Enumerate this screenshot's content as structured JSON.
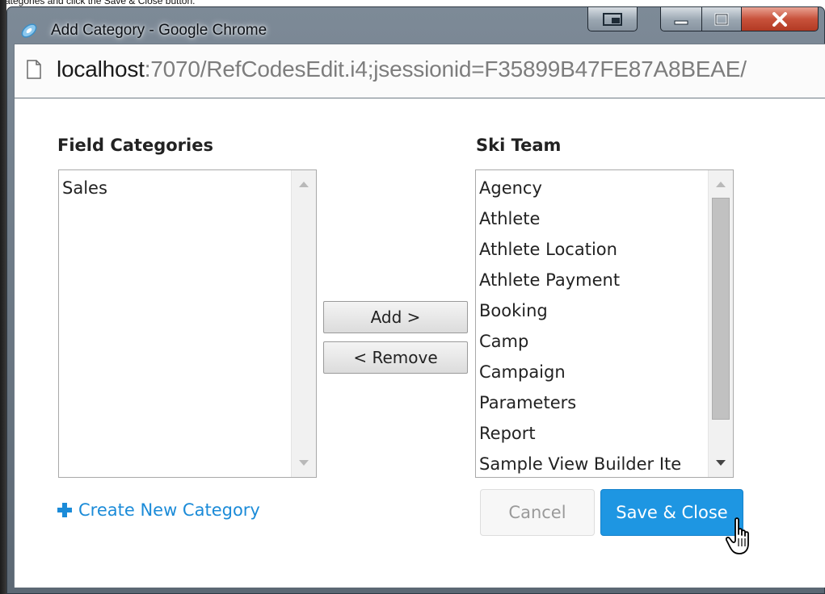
{
  "caption": "categories and click the Save & Close button.",
  "window": {
    "title": "Add Category - Google Chrome",
    "address": {
      "host": "localhost",
      "rest": ":7070/RefCodesEdit.i4;jsessionid=F35899B47FE87A8BEAE/"
    }
  },
  "dialog": {
    "left_heading": "Field Categories",
    "left_items": [
      "Sales"
    ],
    "right_heading": "Ski Team",
    "right_items": [
      "Agency",
      "Athlete",
      "Athlete Location",
      "Athlete Payment",
      "Booking",
      "Camp",
      "Campaign",
      "Parameters",
      "Report",
      "Sample View Builder Ite"
    ],
    "right_scroll_fraction": 0.88,
    "add_label": "Add >",
    "remove_label": "< Remove",
    "create_link": "Create New Category",
    "cancel_label": "Cancel",
    "save_label": "Save & Close"
  },
  "colors": {
    "accent": "#1e96e2",
    "link": "#1b8bd8",
    "close_button": "#c8523b"
  }
}
